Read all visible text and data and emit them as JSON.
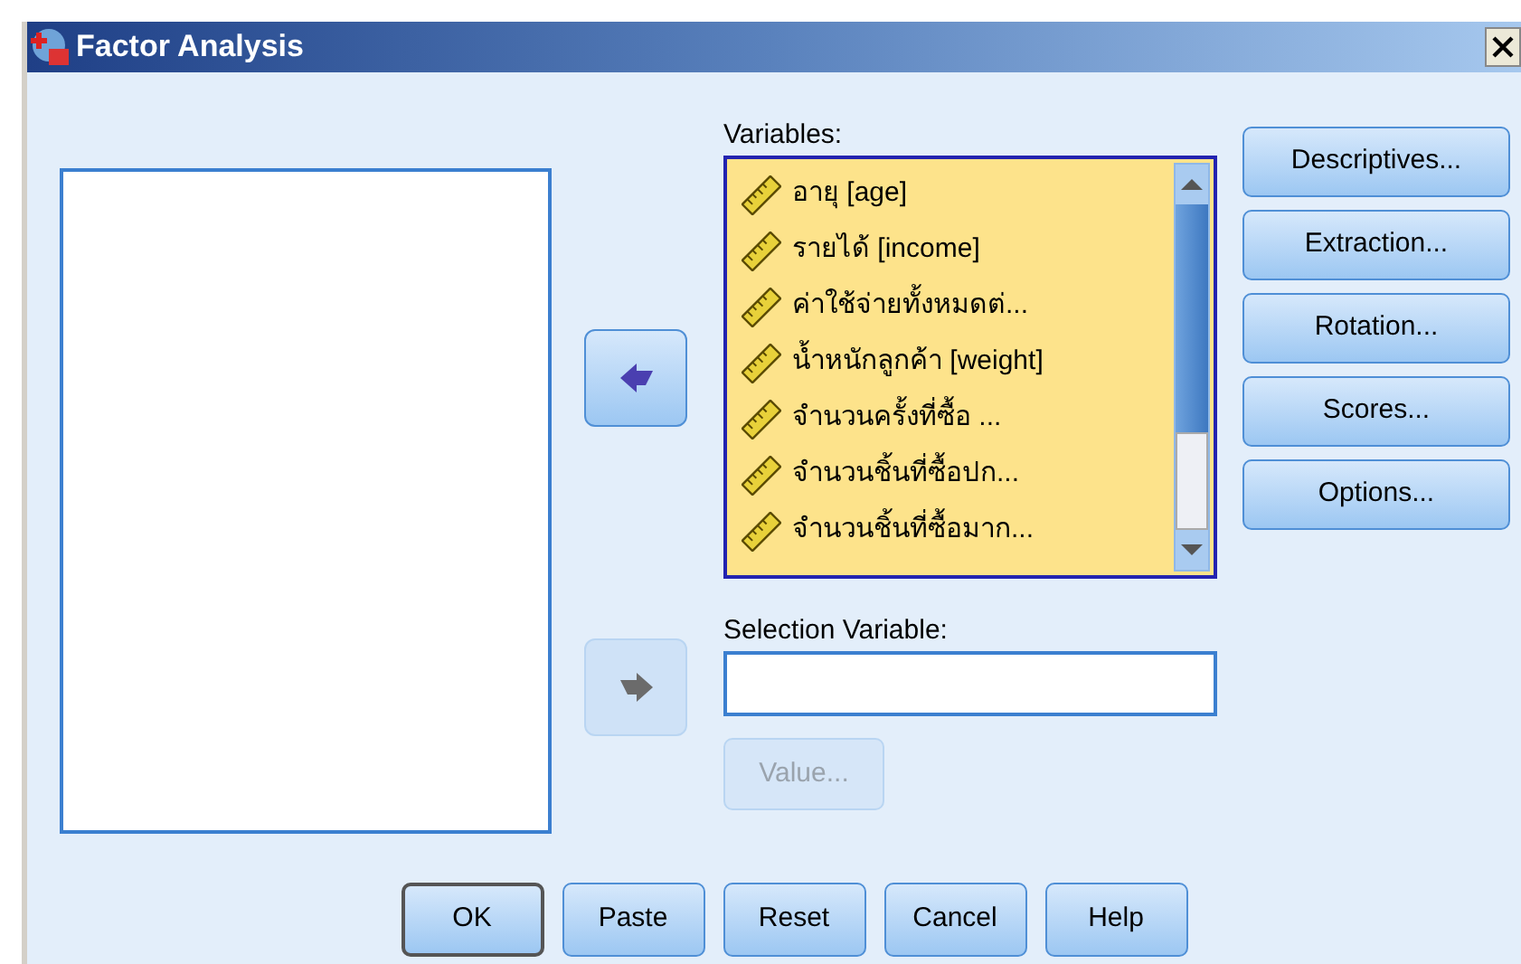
{
  "window": {
    "title": "Factor Analysis"
  },
  "transfer_buttons": [
    {
      "kind": "left",
      "disabled": false
    },
    {
      "kind": "right",
      "disabled": true
    }
  ],
  "variables": {
    "label": "Variables:",
    "items": [
      {
        "label": "อายุ [age]",
        "selected": true
      },
      {
        "label": "รายได้ [income]",
        "selected": true
      },
      {
        "label": "ค่าใช้จ่ายทั้งหมดต่...",
        "selected": true
      },
      {
        "label": "น้ำหนักลูกค้า [weight]",
        "selected": true
      },
      {
        "label": "จำนวนครั้งที่ซื้อ ...",
        "selected": true
      },
      {
        "label": "จำนวนชิ้นที่ซื้อปก...",
        "selected": true
      },
      {
        "label": "จำนวนชิ้นที่ซื้อมาก...",
        "selected": true
      }
    ]
  },
  "selection_variable": {
    "label": "Selection Variable:",
    "value_button": {
      "label": "Value...",
      "disabled": true
    }
  },
  "side_buttons": [
    "Descriptives...",
    "Extraction...",
    "Rotation...",
    "Scores...",
    "Options..."
  ],
  "bottom_buttons": [
    {
      "label": "OK",
      "default": true
    },
    {
      "label": "Paste",
      "default": false
    },
    {
      "label": "Reset",
      "default": false
    },
    {
      "label": "Cancel",
      "default": false
    },
    {
      "label": "Help",
      "default": false
    }
  ]
}
